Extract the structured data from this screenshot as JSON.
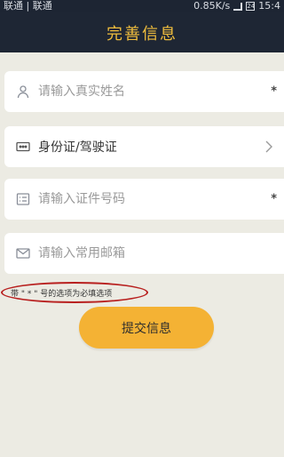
{
  "status_bar": {
    "carrier": "联通 | 联通",
    "speed": "0.85K/s",
    "battery": "24",
    "time": "15:4"
  },
  "header": {
    "title": "完善信息"
  },
  "form": {
    "name_placeholder": "请输入真实姓名",
    "name_required": "*",
    "id_type_value": "身份证/驾驶证",
    "id_number_placeholder": "请输入证件号码",
    "id_number_required": "*",
    "email_placeholder": "请输入常用邮箱"
  },
  "note": "带 \" * \" 号的选项为必填选项",
  "submit_label": "提交信息",
  "colors": {
    "header_bg": "#1e2634",
    "title": "#f1be3d",
    "page_bg": "#ecebe3",
    "button": "#f4b234",
    "annotation_ring": "#b8201f"
  },
  "icons": {
    "name": "user-icon",
    "id_type": "id-card-icon",
    "id_number": "document-list-icon",
    "email": "envelope-icon",
    "id_type_arrow": "chevron-right-icon"
  }
}
